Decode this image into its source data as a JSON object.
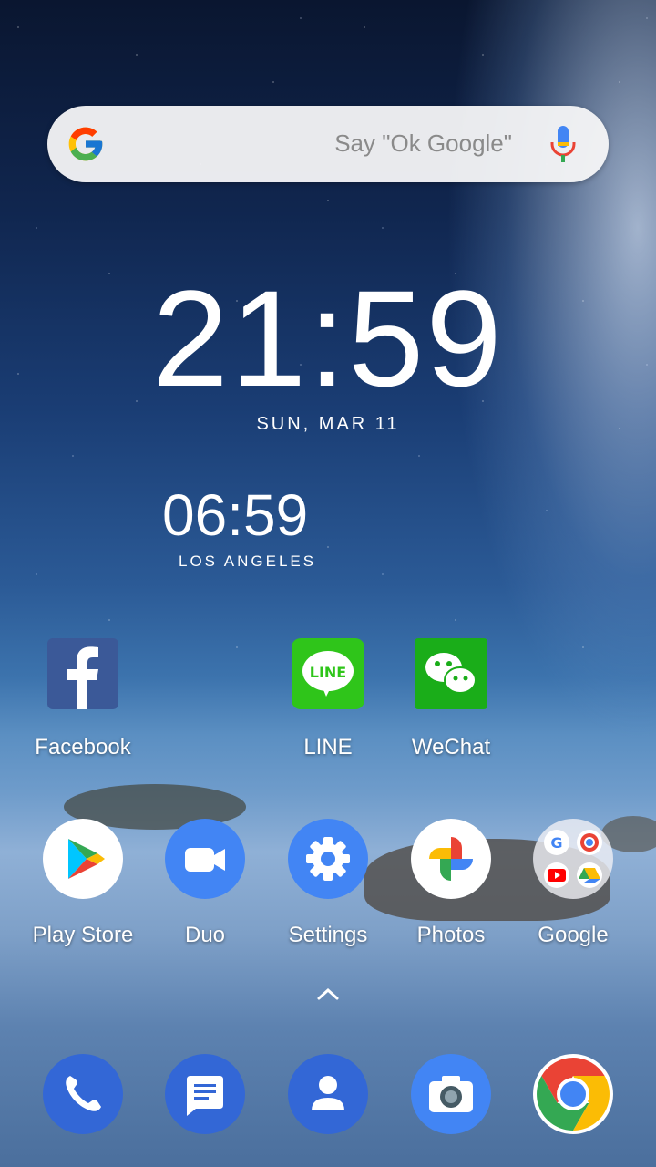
{
  "search": {
    "hint": "Say \"Ok Google\"",
    "logo_icon": "google-g-icon",
    "mic_icon": "microphone-icon"
  },
  "clock": {
    "time": "21:59",
    "date": "SUN, MAR 11"
  },
  "world_clock": {
    "time": "06:59",
    "city": "LOS ANGELES"
  },
  "home_row_1": [
    {
      "label": "Facebook",
      "icon": "facebook-icon",
      "color": "#3b5998"
    },
    {
      "label": "LINE",
      "icon": "line-icon",
      "color": "#2fc51a"
    },
    {
      "label": "WeChat",
      "icon": "wechat-icon",
      "color": "#1aad19"
    }
  ],
  "home_row_2": [
    {
      "label": "Play Store",
      "icon": "play-store-icon"
    },
    {
      "label": "Duo",
      "icon": "duo-icon",
      "color": "#4285f4"
    },
    {
      "label": "Settings",
      "icon": "settings-gear-icon",
      "color": "#4285f4"
    },
    {
      "label": "Photos",
      "icon": "photos-pinwheel-icon"
    },
    {
      "label": "Google",
      "icon": "google-folder-icon"
    }
  ],
  "app_drawer": {
    "icon": "chevron-up-icon"
  },
  "dock": [
    {
      "icon": "phone-icon",
      "color": "#3367d6"
    },
    {
      "icon": "messages-icon",
      "color": "#3367d6"
    },
    {
      "icon": "contacts-icon",
      "color": "#3367d6"
    },
    {
      "icon": "camera-icon",
      "color": "#4285f4"
    },
    {
      "icon": "chrome-icon"
    }
  ]
}
